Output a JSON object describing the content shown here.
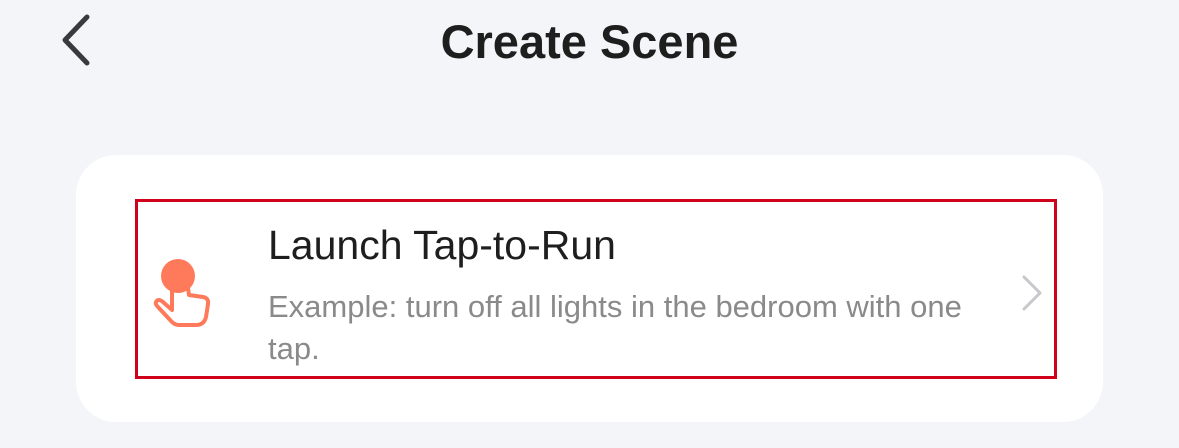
{
  "header": {
    "back_icon": "chevron-left-icon",
    "title": "Create Scene"
  },
  "card": {
    "option": {
      "icon": "tap-finger-icon",
      "icon_color": "#ff7a5a",
      "title": "Launch Tap-to-Run",
      "description": "Example: turn off all lights in the bedroom with one tap.",
      "chevron_icon": "chevron-right-icon"
    }
  },
  "colors": {
    "background": "#f4f5f9",
    "card": "#ffffff",
    "highlight_border": "#d0021b"
  }
}
